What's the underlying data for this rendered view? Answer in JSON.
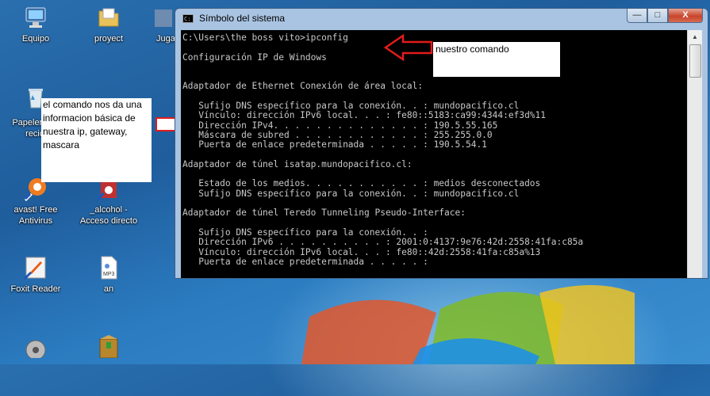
{
  "desktop": {
    "icons": [
      {
        "label": "Equipo"
      },
      {
        "label": "proyect"
      },
      {
        "label": "Juga"
      },
      {
        "label": "Papelera de recicl"
      },
      {
        "label": "avast! Free Antivirus"
      },
      {
        "label": "_alcohol - Acceso directo"
      },
      {
        "label": "Foxit Reader"
      },
      {
        "label": "an"
      }
    ]
  },
  "annotations": {
    "command_note": "nuestro comando",
    "description_note": "el comando nos da una informacion básica de nuestra ip, gateway, mascara"
  },
  "console": {
    "title": "Símbolo del sistema",
    "window_buttons": {
      "minimize": "—",
      "maximize": "□",
      "close": "X"
    },
    "lines": [
      "C:\\Users\\the boss vito>ipconfig",
      "",
      "Configuración IP de Windows",
      "",
      "",
      "Adaptador de Ethernet Conexión de área local:",
      "",
      "   Sufijo DNS específico para la conexión. . : mundopacifico.cl",
      "   Vínculo: dirección IPv6 local. . . : fe80::5183:ca99:4344:ef3d%11",
      "   Dirección IPv4. . . . . . . . . . . . . . : 190.5.55.165",
      "   Máscara de subred . . . . . . . . . . . . : 255.255.0.0",
      "   Puerta de enlace predeterminada . . . . . : 190.5.54.1",
      "",
      "Adaptador de túnel isatap.mundopacifico.cl:",
      "",
      "   Estado de los medios. . . . . . . . . . . : medios desconectados",
      "   Sufijo DNS específico para la conexión. . : mundopacifico.cl",
      "",
      "Adaptador de túnel Teredo Tunneling Pseudo-Interface:",
      "",
      "   Sufijo DNS específico para la conexión. . :",
      "   Dirección IPv6 . . . . . . . . . . : 2001:0:4137:9e76:42d:2558:41fa:c85a",
      "   Vínculo: dirección IPv6 local. . . : fe80::42d:2558:41fa:c85a%13",
      "   Puerta de enlace predeterminada . . . . . :"
    ]
  }
}
